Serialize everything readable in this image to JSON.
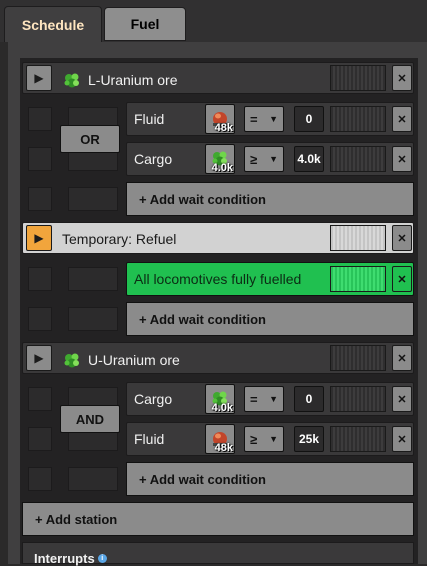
{
  "tabs": [
    {
      "label": "Schedule"
    },
    {
      "label": "Fuel"
    }
  ],
  "stations": [
    {
      "name": "L-Uranium ore",
      "logic": "OR",
      "conditions": [
        {
          "label": "Fluid",
          "item": "crude-oil-barrel",
          "count": "48k",
          "comparator": "=",
          "value": "0"
        },
        {
          "label": "Cargo",
          "item": "uranium-ore",
          "count": "4.0k",
          "comparator": "≥",
          "value": "4.0k"
        }
      ],
      "add_wait_label": "+ Add wait condition"
    },
    {
      "name": "Temporary: Refuel",
      "conditions": [
        {
          "label": "All locomotives fully fuelled"
        }
      ],
      "add_wait_label": "+ Add wait condition"
    },
    {
      "name": "U-Uranium ore",
      "logic": "AND",
      "conditions": [
        {
          "label": "Cargo",
          "item": "uranium-ore",
          "count": "4.0k",
          "comparator": "=",
          "value": "0"
        },
        {
          "label": "Fluid",
          "item": "crude-oil-barrel",
          "count": "48k",
          "comparator": "≥",
          "value": "25k"
        }
      ],
      "add_wait_label": "+ Add wait condition"
    }
  ],
  "add_station_label": "+ Add station",
  "interrupts_label": "Interrupts",
  "icons": {
    "play": "play-icon",
    "close": "close-icon",
    "dropdown": "chevron-down-icon",
    "info": "info-icon"
  },
  "colors": {
    "accent_orange": "#f1a53c",
    "fulfilled_green": "#20c050",
    "button_gray": "#8b8b8b",
    "tab_active_text": "#ffe6c0"
  }
}
